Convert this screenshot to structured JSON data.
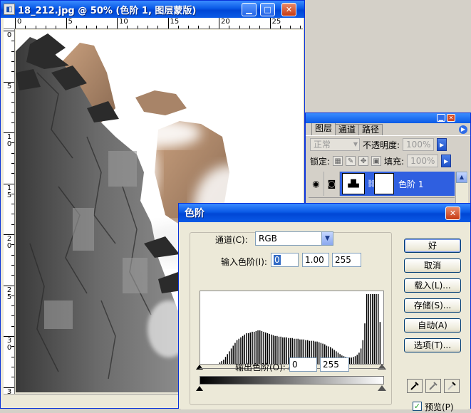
{
  "doc_window": {
    "title": "18_212.jpg @ 50% (色阶 1, 图层蒙版)",
    "icon": "photoshop-doc-icon",
    "ruler_top_labels": [
      "0",
      "5",
      "10",
      "15",
      "20",
      "25"
    ],
    "ruler_left_labels": [
      "0",
      "5",
      "1\n0",
      "1\n5",
      "2\n0",
      "2\n5",
      "3\n0",
      "3"
    ]
  },
  "layers_panel": {
    "tabs": [
      "图层",
      "通道",
      "路径"
    ],
    "blend_mode": "正常",
    "opacity_label": "不透明度:",
    "opacity_value": "100%",
    "lock_label": "锁定:",
    "fill_label": "填充:",
    "fill_value": "100%",
    "layer_name": "色阶 1"
  },
  "levels_dialog": {
    "title": "色阶",
    "channel_label": "通道(C):",
    "channel_value": "RGB",
    "input_label": "输入色阶(I):",
    "input_black": "0",
    "input_gamma": "1.00",
    "input_white": "255",
    "output_label": "输出色阶(O):",
    "output_black": "0",
    "output_white": "255",
    "buttons": {
      "ok": "好",
      "cancel": "取消",
      "load": "载入(L)...",
      "save": "存储(S)...",
      "auto": "自动(A)",
      "options": "选项(T)..."
    },
    "preview_label": "预览(P)",
    "preview_checked": true
  },
  "chart_data": {
    "type": "bar",
    "x_range": [
      0,
      255
    ],
    "values": [
      0,
      0,
      0,
      0,
      0,
      0,
      0,
      0,
      0,
      0,
      2,
      4,
      6,
      10,
      14,
      18,
      22,
      26,
      30,
      34,
      36,
      38,
      40,
      42,
      44,
      44,
      45,
      46,
      46,
      47,
      48,
      48,
      47,
      46,
      45,
      44,
      43,
      42,
      41,
      40,
      40,
      39,
      39,
      38,
      38,
      38,
      37,
      37,
      37,
      36,
      36,
      36,
      35,
      35,
      35,
      34,
      34,
      33,
      33,
      33,
      32,
      32,
      31,
      30,
      29,
      28,
      26,
      25,
      24,
      22,
      20,
      18,
      16,
      14,
      12,
      11,
      10,
      9,
      9,
      9,
      10,
      11,
      13,
      16,
      22,
      34,
      58,
      100,
      100,
      100,
      100,
      100,
      100,
      100,
      60,
      0
    ]
  }
}
